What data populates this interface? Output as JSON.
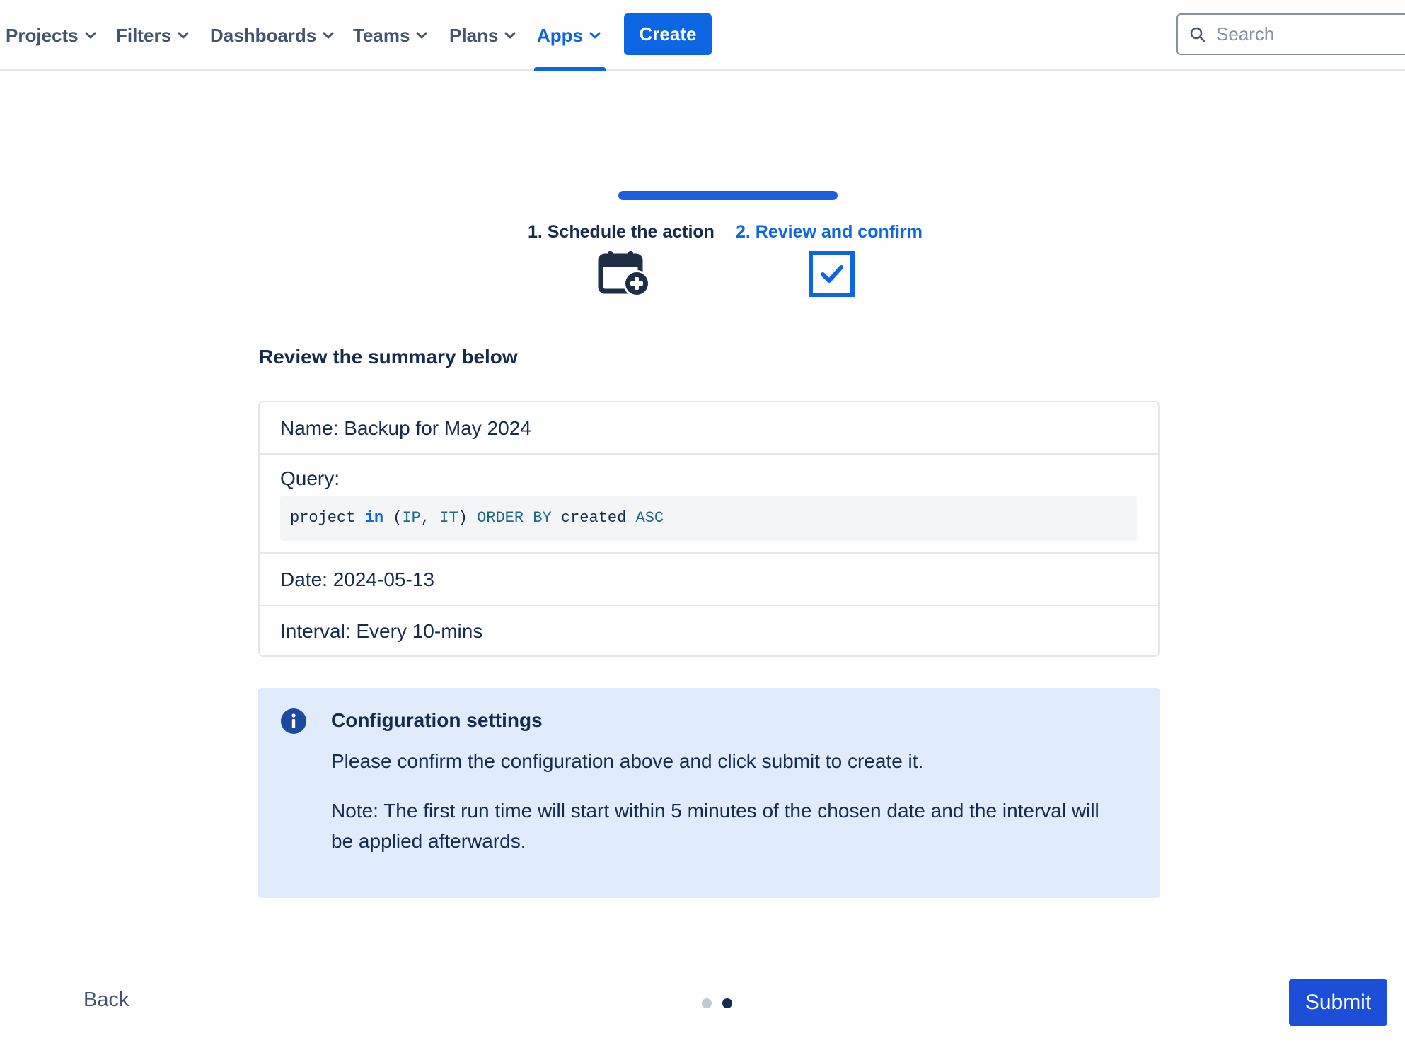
{
  "nav": {
    "items": [
      {
        "label": "Projects"
      },
      {
        "label": "Filters"
      },
      {
        "label": "Dashboards"
      },
      {
        "label": "Teams"
      },
      {
        "label": "Plans"
      },
      {
        "label": "Apps"
      }
    ],
    "active": "Apps",
    "create_label": "Create",
    "search_placeholder": "Search"
  },
  "wizard": {
    "progress_fraction": 1.0,
    "steps": [
      {
        "label": "1. Schedule the action",
        "icon": "calendar-add-icon",
        "state": "completed"
      },
      {
        "label": "2. Review and confirm",
        "icon": "checkbox-checked-icon",
        "state": "current"
      }
    ]
  },
  "summary": {
    "title": "Review the summary below",
    "name": "Name: Backup for May 2024",
    "query_label": "Query:",
    "query_tokens": {
      "field": "project ",
      "op": "in",
      "open": " (",
      "v1": "IP",
      "comma": ", ",
      "v2": "IT",
      "close": ") ",
      "order": "ORDER BY",
      "created": " created ",
      "asc": "ASC"
    },
    "date": "Date: 2024-05-13",
    "interval": "Interval: Every 10-mins"
  },
  "info": {
    "icon": "info-icon",
    "title": "Configuration settings",
    "text": "Please confirm the configuration above and click submit to create it.",
    "note": "Note: The first run time will start within 5 minutes of the chosen date and the interval will be applied afterwards."
  },
  "footer": {
    "back_label": "Back",
    "submit_label": "Submit",
    "pagination": {
      "total": 2,
      "current": 2
    }
  },
  "colors": {
    "primary": "#0c66e4",
    "submit": "#1d4ed8",
    "info_bg": "#e0ebfb",
    "text": "#172b4d"
  }
}
